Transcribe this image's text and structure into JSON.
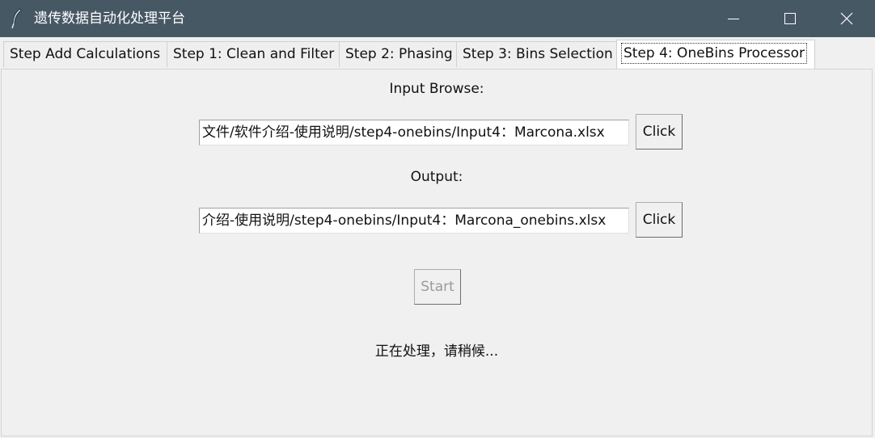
{
  "window": {
    "title": "遗传数据自动化处理平台",
    "icon": "feather-icon",
    "controls": [
      "minimize-icon",
      "maximize-icon",
      "close-icon"
    ],
    "titlebar_color": "#475865"
  },
  "tabs": [
    {
      "label": "Step Add Calculations",
      "active": false
    },
    {
      "label": "Step 1: Clean and Filter",
      "active": false
    },
    {
      "label": "Step 2: Phasing",
      "active": false
    },
    {
      "label": "Step 3: Bins Selection",
      "active": false
    },
    {
      "label": "Step 4: OneBins Processor",
      "active": true
    }
  ],
  "panel": {
    "input_label": "Input Browse:",
    "input_value": "文件/软件介绍-使用说明/step4-onebins/Input4：Marcona.xlsx",
    "input_button": "Click",
    "output_label": "Output:",
    "output_value": "介绍-使用说明/step4-onebins/Input4：Marcona_onebins.xlsx",
    "output_button": "Click",
    "start_button": "Start",
    "start_enabled": false,
    "status": "正在处理，请稍候..."
  }
}
